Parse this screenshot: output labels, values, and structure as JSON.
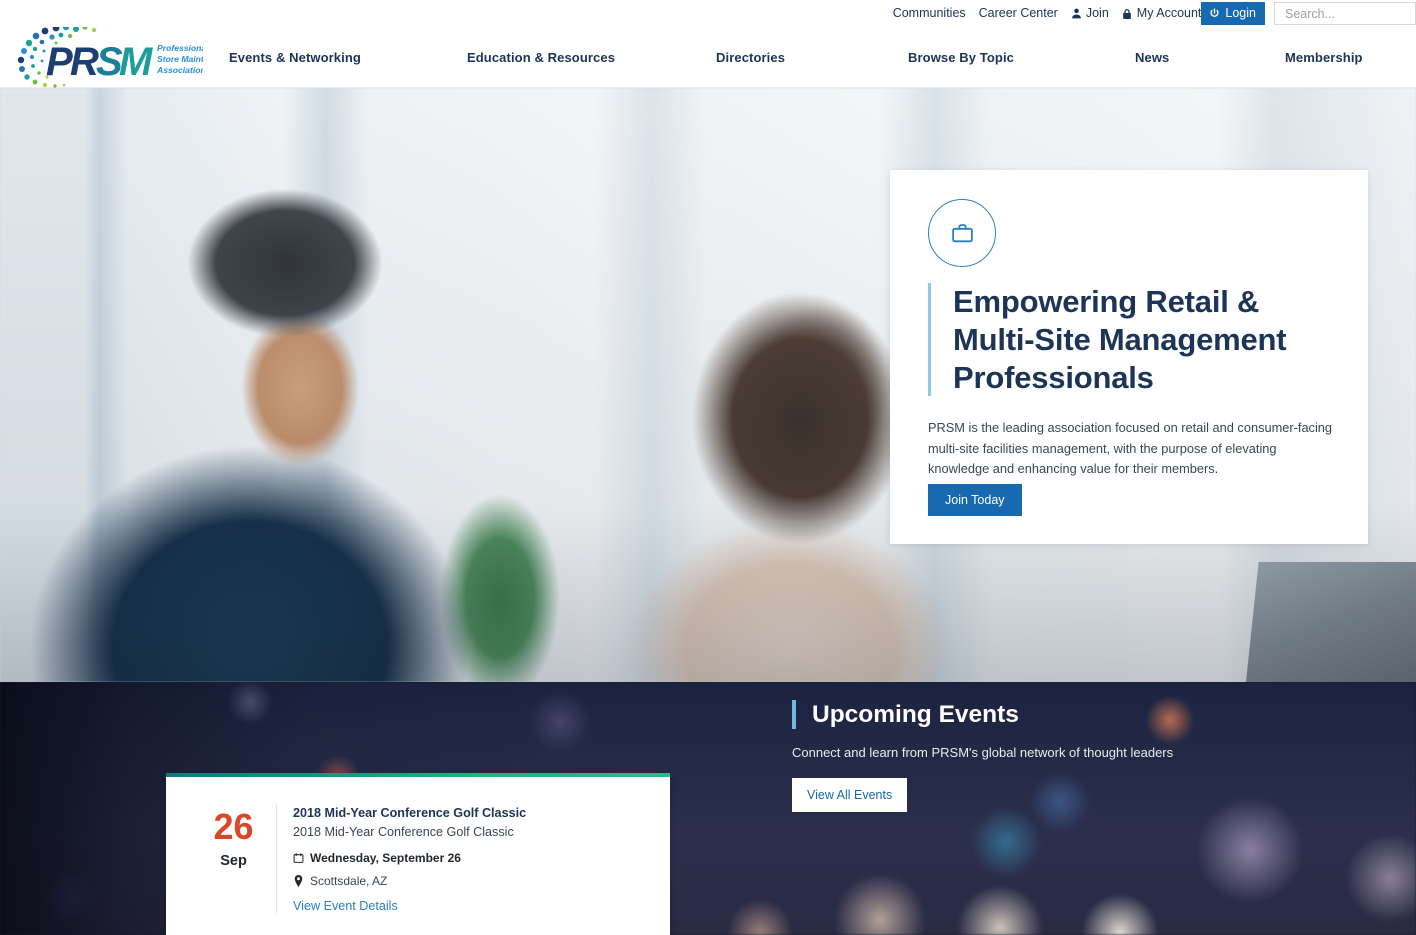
{
  "utility_bar": {
    "links": [
      {
        "label": "Communities",
        "icon": ""
      },
      {
        "label": "Career Center",
        "icon": ""
      },
      {
        "label": "Join",
        "icon": "user-icon"
      },
      {
        "label": "My Account",
        "icon": "lock-icon"
      }
    ],
    "login_label": "Login",
    "login_icon": "power-icon",
    "login_bg": "#1769b0",
    "search_placeholder": "Search...",
    "search_value": ""
  },
  "brand": {
    "name": "PRSM",
    "tagline_line1": "Professional Retail",
    "tagline_line2": "Store Maintenance",
    "tagline_line3": "Association",
    "colors": {
      "dark_blue": "#1c3e72",
      "teal": "#1f9d9b",
      "green": "#6cbe45",
      "light_blue": "#2a8fd0"
    }
  },
  "main_nav": {
    "items": [
      {
        "label": "Events & Networking"
      },
      {
        "label": "Education & Resources"
      },
      {
        "label": "Directories"
      },
      {
        "label": "Browse By Topic"
      },
      {
        "label": "News"
      },
      {
        "label": "Membership"
      }
    ],
    "text_color": "#1c3557"
  },
  "hero": {
    "icon": "briefcase-icon",
    "heading": "Empowering Retail & Multi-Site Management Professionals",
    "body": "PRSM is the leading association focused on retail and consumer-facing multi-site facilities management, with the purpose of elevating knowledge and enhancing value for their members.",
    "cta_label": "Join Today",
    "accent_color": "#8ecae6",
    "heading_color": "#1c3557",
    "cta_bg": "#1769b0"
  },
  "events_section": {
    "heading": "Upcoming Events",
    "subheading": "Connect and learn from PRSM's global network of thought leaders",
    "view_all_label": "View All Events",
    "accent_color": "#6fb8d8",
    "card": {
      "day": "26",
      "month": "Sep",
      "day_color": "#d9472b",
      "title": "2018 Mid-Year Conference Golf Classic",
      "description": "2018 Mid-Year Conference Golf Classic",
      "date_icon": "calendar-icon",
      "date_text": "Wednesday, September 26",
      "location_icon": "map-pin-icon",
      "location_text": "Scottsdale, AZ",
      "link_label": "View Event Details",
      "link_color": "#2a7fc0",
      "top_border_colors": [
        "#11797e",
        "#2cb987"
      ]
    }
  }
}
